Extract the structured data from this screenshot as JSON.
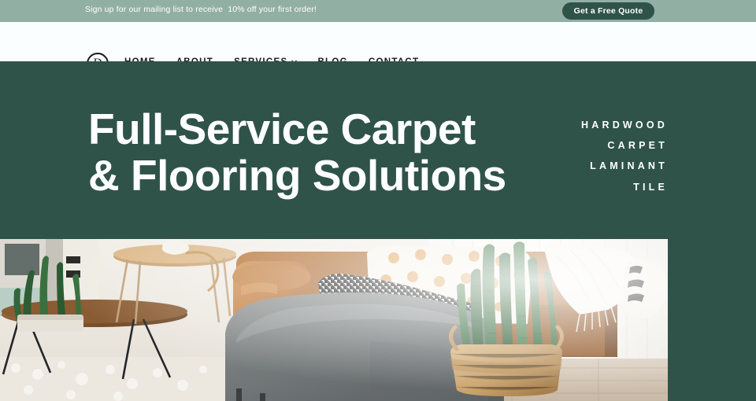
{
  "announcement": {
    "text": "Sign up for our mailing list to receive  10% off your first order!",
    "cta_label": "Get a Free Quote",
    "background_color": "#92afa4",
    "cta_background_color": "#2f5349",
    "text_color": "#ffffff"
  },
  "nav": {
    "logo_letter": "D",
    "logo_name": "divi-logo",
    "background_color": "#fbfeff",
    "text_color": "#15191c",
    "items": [
      {
        "label": "HOME",
        "has_dropdown": false
      },
      {
        "label": "ABOUT",
        "has_dropdown": false
      },
      {
        "label": "SERVICES",
        "has_dropdown": true,
        "dropdown_icon": "chevron-down-icon"
      },
      {
        "label": "BLOG",
        "has_dropdown": false
      },
      {
        "label": "CONTACT",
        "has_dropdown": false
      }
    ]
  },
  "hero": {
    "title": "Full-Service Carpet\n& Flooring Solutions",
    "title_color": "#ffffff",
    "background_color": "#2f5349",
    "services": [
      {
        "label": "HARDWOOD"
      },
      {
        "label": "CARPET"
      },
      {
        "label": "LAMINANT"
      },
      {
        "label": "TILE"
      }
    ]
  },
  "hero_image": {
    "description": "Living room interior with gray armchair, brown leather sofa with pillows, wooden side tables, snake plant in woven basket and sheer curtains",
    "name": "hero-living-room-photo"
  }
}
